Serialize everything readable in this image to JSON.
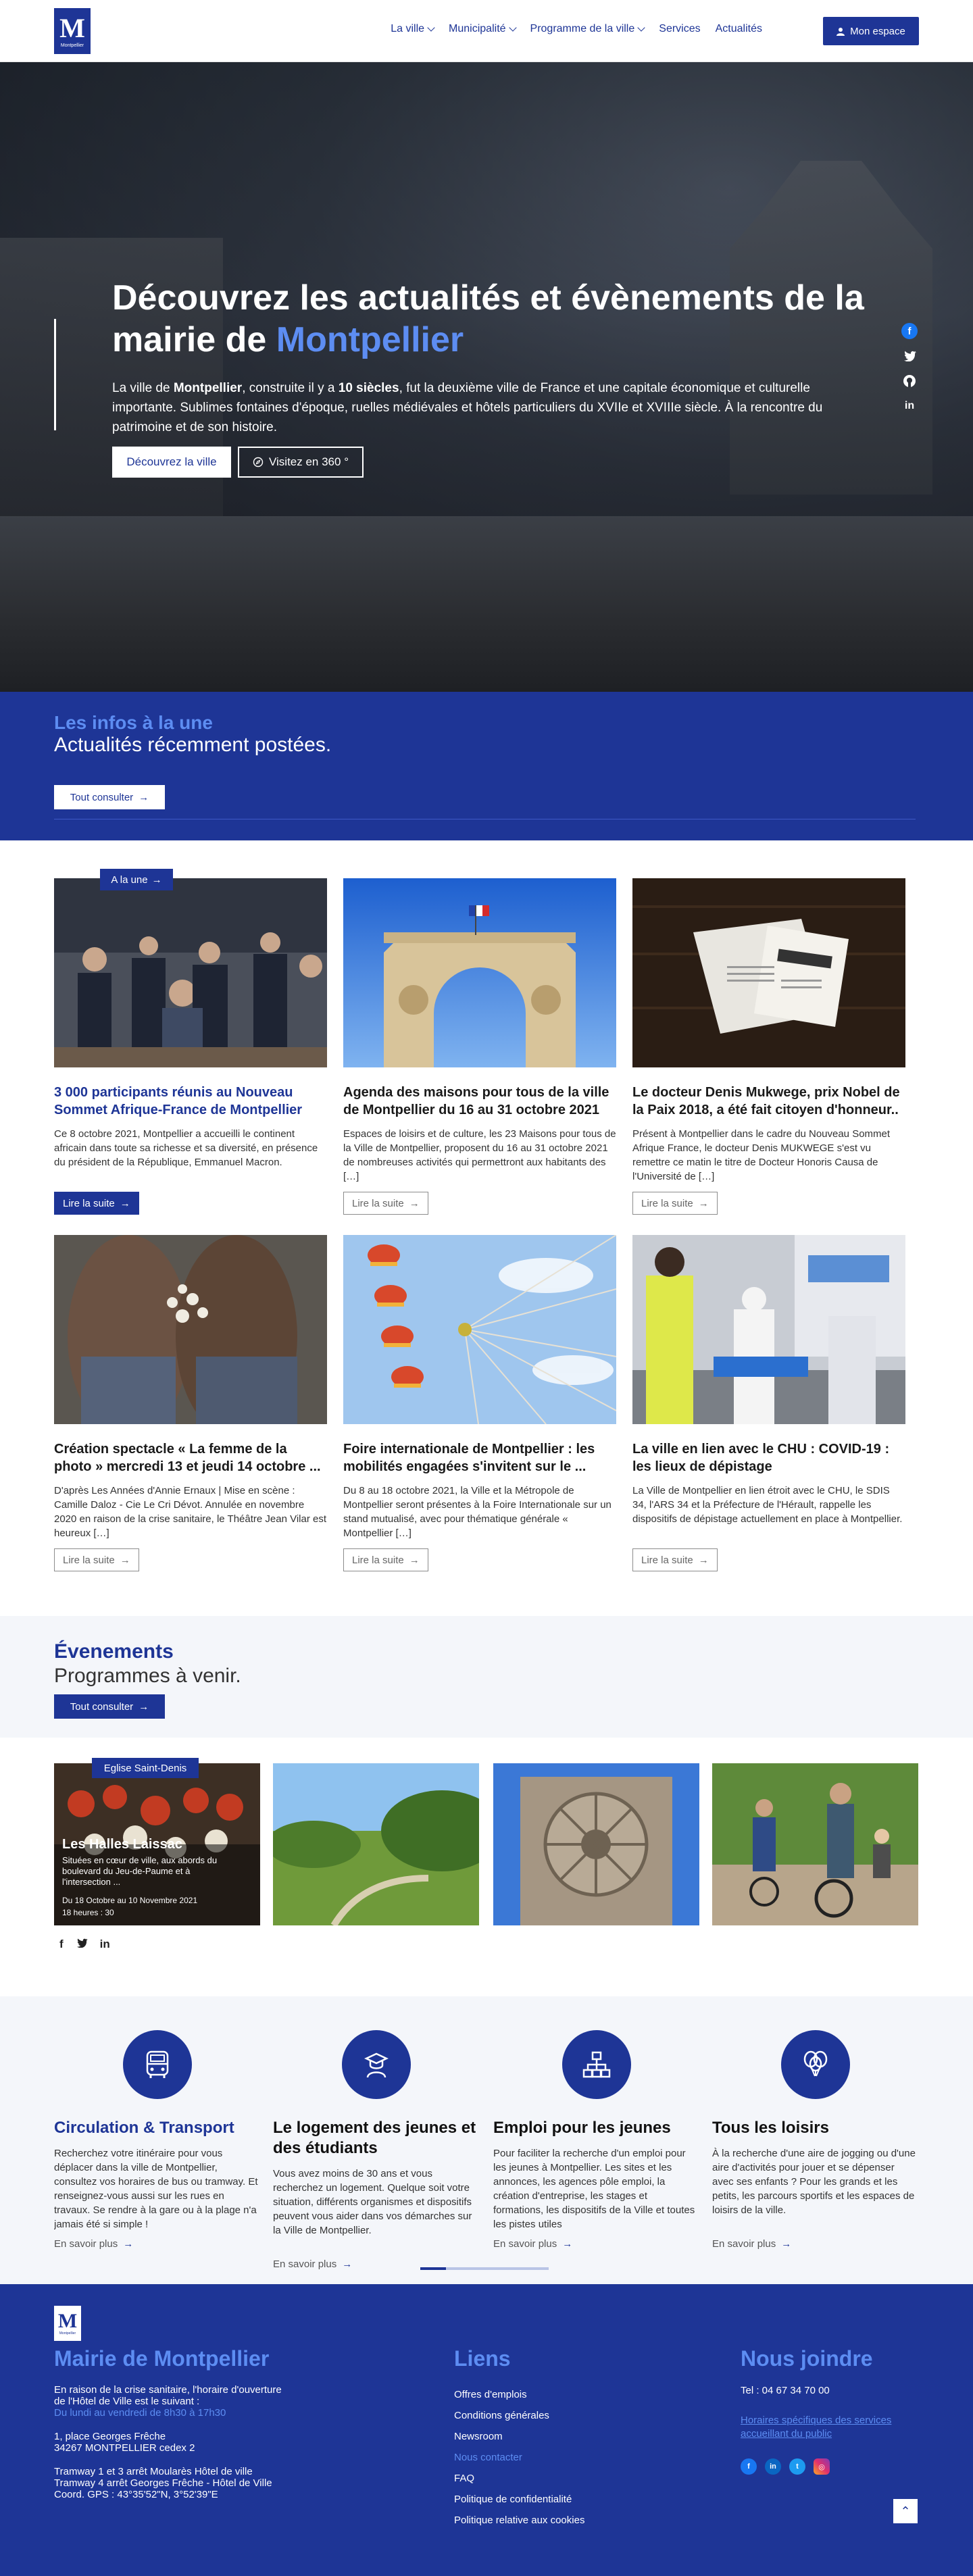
{
  "nav": {
    "logo_letter": "M",
    "logo_text": "Montpellier",
    "items": [
      "La ville",
      "Municipalité",
      "Programme de la ville",
      "Services",
      "Actualités"
    ],
    "space_label": "Mon espace"
  },
  "hero": {
    "title_part1": "Découvrez les actualités et évènements de la mairie de ",
    "title_accent": "Montpellier",
    "text_a": "La ville de ",
    "text_b": "Montpellier",
    "text_c": ", construite il y a ",
    "text_d": "10 siècles",
    "text_e": ", fut la deuxième ville de France et une capitale économique et culturelle importante. Sublimes fontaines d'époque, ruelles médiévales et hôtels particuliers du XVIIe et XVIIIe siècle. À la rencontre du patrimoine et de son histoire.",
    "cta_primary": "Découvrez la ville",
    "cta_secondary": "Visitez en  360 °",
    "socials": [
      "facebook-icon",
      "twitter-icon",
      "github-icon",
      "linkedin-icon"
    ]
  },
  "infos": {
    "kicker": "Les infos à la une",
    "title": "Actualités récemment postées.",
    "button": "Tout consulter"
  },
  "news": {
    "badge": "A la une",
    "cards": [
      {
        "title": "3 000 participants réunis au Nouveau Sommet Afrique-France de Montpellier",
        "text": "Ce 8 octobre 2021, Montpellier a accueilli le continent africain dans toute sa richesse et sa diversité, en présence du président de la République, Emmanuel Macron.",
        "more": "Lire la suite"
      },
      {
        "title": "Agenda des maisons pour tous de la ville de Montpellier du 16 au 31 octobre 2021",
        "text": "Espaces de loisirs et de culture, les 23 Maisons pour tous de la Ville de Montpellier, proposent du 16 au 31 octobre 2021 de nombreuses activités qui permettront aux habitants des […]",
        "more": "Lire la suite"
      },
      {
        "title": "Le docteur Denis Mukwege, prix Nobel de la Paix 2018, a été fait citoyen d'honneur..",
        "text": "Présent à Montpellier dans le cadre du Nouveau Sommet Afrique France, le docteur Denis MUKWEGE s'est vu remettre ce matin le titre de Docteur Honoris Causa de l'Université de […]",
        "more": "Lire la suite"
      },
      {
        "title": "Création spectacle « La femme de la photo » mercredi 13 et jeudi 14 octobre ...",
        "text": "D'après Les Années d'Annie Ernaux | Mise en scène : Camille Daloz - Cie Le Cri Dévot. Annulée en novembre 2020 en raison de la crise sanitaire, le Théâtre Jean Vilar est heureux […]",
        "more": "Lire la suite"
      },
      {
        "title": "Foire internationale de Montpellier : les mobilités engagées s'invitent sur le ...",
        "text": "Du 8 au 18 octobre 2021, la Ville et la Métropole de Montpellier seront présentes à la Foire Internationale sur un stand mutualisé, avec pour thématique générale « Montpellier […]",
        "more": "Lire la suite"
      },
      {
        "title": "La ville en lien avec le CHU : COVID-19 : les lieux de dépistage",
        "text": "La Ville de Montpellier en lien étroit avec le CHU, le SDIS 34, l'ARS 34 et la Préfecture de l'Hérault, rappelle les dispositifs de dépistage actuellement en place à Montpellier.",
        "more": "Lire la suite"
      }
    ]
  },
  "events": {
    "title": "Évenements",
    "subtitle": "Programmes à venir.",
    "button": "Tout consulter",
    "badge": "Eglise Saint-Denis",
    "featured": {
      "name": "Les Halles Laissac",
      "desc": "Situées en cœur de ville, aux abords du boulevard du Jeu-de-Paume et à l'intersection ...",
      "date": "Du 18 Octobre au 10 Novembre 2021",
      "time": "18 heures : 30"
    },
    "socials": [
      "f",
      "t",
      "in"
    ]
  },
  "services": [
    {
      "title": "Circulation & Transport",
      "text": "Recherchez votre itinéraire pour vous déplacer dans la ville de Montpellier, consultez vos horaires de bus ou tramway. Et renseignez-vous aussi sur les rues en travaux. Se rendre à la gare ou à la plage n'a jamais été si simple !",
      "more": "En savoir plus",
      "icon": "bus-icon"
    },
    {
      "title": "Le logement des jeunes et des étudiants",
      "text": "Vous avez moins de 30 ans et vous recherchez un logement. Quelque soit votre situation, différents organismes et dispositifs peuvent vous aider dans vos démarches sur la Ville de Montpellier.",
      "more": "En savoir plus",
      "icon": "student-icon"
    },
    {
      "title": "Emploi pour les jeunes",
      "text": "Pour faciliter la recherche d'un emploi pour les jeunes à Montpellier. Les sites et les annonces, les agences pôle emploi, la création d'entreprise, les stages et formations, les dispositifs de la Ville et toutes les pistes utiles",
      "more": "En savoir plus",
      "icon": "network-icon"
    },
    {
      "title": "Tous les loisirs",
      "text": "À la recherche d'une aire de jogging ou d'une aire d'activités pour jouer et se dépenser avec ses enfants ? Pour les grands et les petits, les parcours sportifs et les espaces de loisirs de la ville.",
      "more": "En savoir plus",
      "icon": "balloons-icon"
    }
  ],
  "footer": {
    "logo_letter": "M",
    "logo_text": "Montpellier",
    "col1_title": "Mairie de Montpellier",
    "col1_l1": "En raison de la crise sanitaire, l'horaire d'ouverture",
    "col1_l2": "de l'Hôtel de Ville est le suivant :",
    "col1_hours": "Du lundi au vendredi de 8h30 à 17h30",
    "addr1": "1, place Georges Frêche",
    "addr2": "34267 MONTPELLIER cedex 2",
    "tram1": "Tramway 1 et 3 arrêt Moularès Hôtel de ville",
    "tram2": "Tramway 4 arrêt Georges Frêche - Hôtel de Ville",
    "gps": "Coord. GPS : 43°35'52\"N, 3°52'39\"E",
    "col2_title": "Liens",
    "links": [
      "Offres d'emplois",
      "Conditions générales",
      "Newsroom",
      "Nous contacter",
      "FAQ",
      "Politique de confidentialité",
      "Politique relative aux cookies"
    ],
    "col3_title": "Nous joindre",
    "phone": "Tel : 04 67 34 70 00",
    "hours_link": "Horaires spécifiques des services accueillant du public",
    "socials": [
      "facebook-icon",
      "linkedin-icon",
      "twitter-icon",
      "instagram-icon"
    ]
  }
}
